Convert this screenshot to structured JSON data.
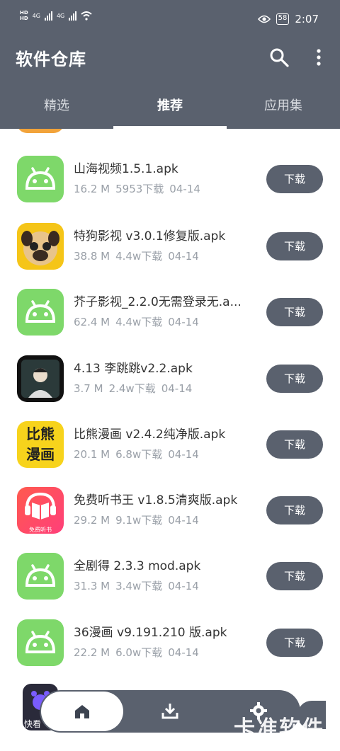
{
  "status_bar": {
    "hd1": "HD",
    "hd2": "HD",
    "net1": "4G",
    "net2": "4G",
    "battery": "58",
    "time": "2:07"
  },
  "header": {
    "title": "软件仓库",
    "search_icon": "search-icon",
    "more_icon": "more-vertical-icon",
    "background_color": "#5a616e"
  },
  "tabs": [
    {
      "label": "精选",
      "active": false
    },
    {
      "label": "推荐",
      "active": true
    },
    {
      "label": "应用集",
      "active": false
    }
  ],
  "apps": [
    {
      "name": "山海视频1.5.1.apk",
      "size": "16.2 M",
      "downloads": "5953下载",
      "date": "04-14",
      "button": "下载",
      "icon": "android-icon"
    },
    {
      "name": "特狗影视 v3.0.1修复版.apk",
      "size": "38.8 M",
      "downloads": "4.4w下载",
      "date": "04-14",
      "button": "下载",
      "icon": "pug-icon"
    },
    {
      "name": "芥子影视_2.2.0无需登录无.a...",
      "size": "62.4 M",
      "downloads": "4.4w下载",
      "date": "04-14",
      "button": "下载",
      "icon": "android-icon"
    },
    {
      "name": "4.13 李跳跳v2.2.apk",
      "size": "3.7 M",
      "downloads": "2.4w下载",
      "date": "04-14",
      "button": "下载",
      "icon": "avatar-icon"
    },
    {
      "name": "比熊漫画 v2.4.2纯净版.apk",
      "size": "20.1 M",
      "downloads": "6.8w下载",
      "date": "04-14",
      "button": "下载",
      "icon": "bixiong-icon",
      "icon_text": [
        "比熊",
        "漫画"
      ]
    },
    {
      "name": "免费听书王 v1.8.5清爽版.apk",
      "size": "29.2 M",
      "downloads": "9.1w下载",
      "date": "04-14",
      "button": "下载",
      "icon": "book-headphones-icon",
      "icon_text": [
        "免费听书"
      ]
    },
    {
      "name": "全剧得 2.3.3   mod.apk",
      "size": "31.3 M",
      "downloads": "3.4w下载",
      "date": "04-14",
      "button": "下载",
      "icon": "android-icon"
    },
    {
      "name": "36漫画 v9.191.210 版.apk",
      "size": "22.2 M",
      "downloads": "6.0w下载",
      "date": "04-14",
      "button": "下载",
      "icon": "android-icon"
    }
  ],
  "last_app_caption": "快看",
  "bottom_nav": {
    "home_icon": "home-icon",
    "download_icon": "download-icon",
    "settings_icon": "gear-icon"
  },
  "watermark": "卡准软件"
}
